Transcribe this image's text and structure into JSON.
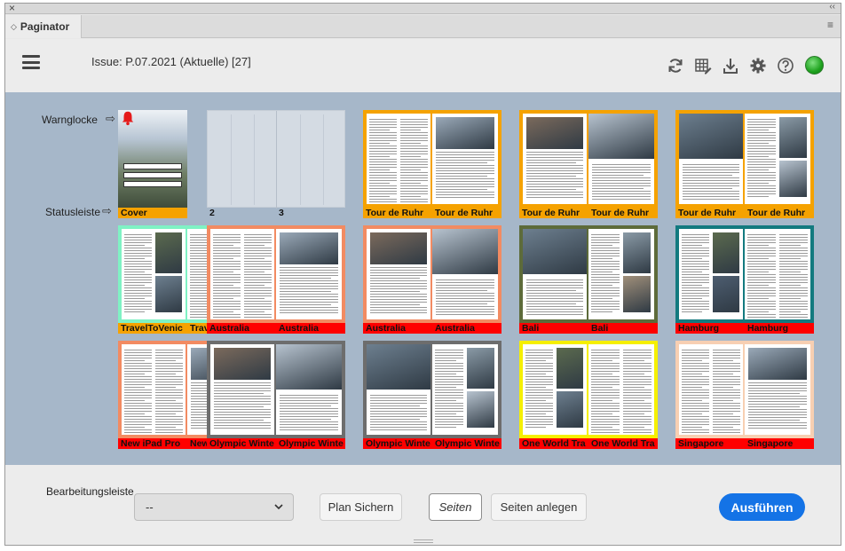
{
  "panel": {
    "tab_label": "Paginator",
    "close_glyph": "×",
    "collapse_glyph": "‹‹",
    "menu_glyph": "≡",
    "tab_arrows_glyph": "◇"
  },
  "header": {
    "issue_title": "Issue: P.07.2021 (Aktuelle) [27]",
    "tools": [
      "refresh-icon",
      "grid-edit-icon",
      "download-icon",
      "gear-icon",
      "help-icon"
    ],
    "status_color": "#1ea21e"
  },
  "annotations": {
    "bell_label": "Warnglocke",
    "status_label": "Statusleiste",
    "arrow_glyph": "⇨"
  },
  "colors": {
    "orange": "#f5a200",
    "mint": "#7ff2c4",
    "salmon": "#f28b62",
    "olive": "#5d6b3a",
    "teal": "#137a7f",
    "gray": "#6d6d6d",
    "yellow": "#f5ef00",
    "peach": "#f7cfb2",
    "red": "#ff0000"
  },
  "spreads": [
    {
      "left_label": "Cover",
      "right_label": "",
      "frame": "none",
      "bar": "orange"
    },
    {
      "left_label": "2",
      "right_label": "3",
      "frame": "empty",
      "bar": "none"
    },
    {
      "left_label": "Tour de Ruhr",
      "right_label": "Tour de Ruhr",
      "frame": "orange",
      "bar": "orange"
    },
    {
      "left_label": "Tour de Ruhr",
      "right_label": "Tour de Ruhr",
      "frame": "orange",
      "bar": "orange"
    },
    {
      "left_label": "Tour de Ruhr",
      "right_label": "Tour de Ruhr",
      "frame": "orange",
      "bar": "orange"
    },
    {
      "left_label": "TravelToVenic",
      "right_label": "TravelToVenic",
      "frame": "mint",
      "bar": "orange"
    },
    {
      "left_label": "Australia",
      "right_label": "Australia",
      "frame": "salmon",
      "bar": "red"
    },
    {
      "left_label": "Australia",
      "right_label": "Australia",
      "frame": "salmon",
      "bar": "red"
    },
    {
      "left_label": "Bali",
      "right_label": "Bali",
      "frame": "olive",
      "bar": "red"
    },
    {
      "left_label": "Hamburg",
      "right_label": "Hamburg",
      "frame": "teal",
      "bar": "red"
    },
    {
      "left_label": "New iPad Pro",
      "right_label": "New iPad Pro",
      "frame": "salmon",
      "bar": "red"
    },
    {
      "left_label": "Olympic Winte",
      "right_label": "Olympic Winte",
      "frame": "gray",
      "bar": "red"
    },
    {
      "left_label": "Olympic Winte",
      "right_label": "Olympic Winte",
      "frame": "gray",
      "bar": "red"
    },
    {
      "left_label": "One World Tra",
      "right_label": "One World Tra",
      "frame": "yellow",
      "bar": "red"
    },
    {
      "left_label": "Singapore",
      "right_label": "Singapore",
      "frame": "peach",
      "bar": "red"
    }
  ],
  "bottom": {
    "bearbeitungsleiste_label": "Bearbeitungsleiste",
    "dropdown_value": "--",
    "plan_button": "Plan Sichern",
    "seiten_button": "Seiten",
    "seiten_anlegen_button": "Seiten anlegen",
    "run_button": "Ausführen"
  }
}
